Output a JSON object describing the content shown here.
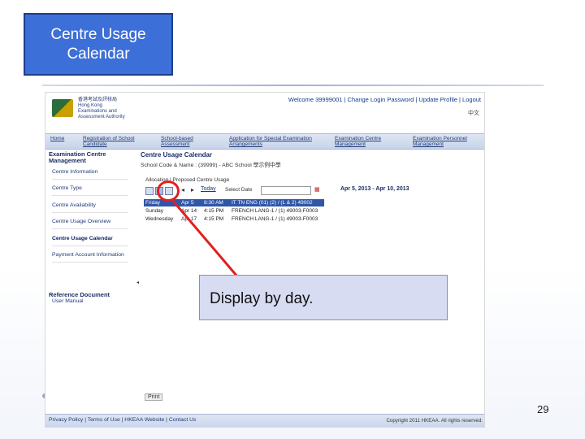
{
  "slide": {
    "title": "Centre Usage\nCalendar",
    "callout": "Display by day.",
    "page_number": "29"
  },
  "portal": {
    "logo_text": "香港考試及評核局\nHong Kong\nExaminations and\nAssessment Authority",
    "top_links": "Welcome 39999001 | Change Login Password | Update Profile | Logout",
    "language": "中文",
    "nav": [
      "Home",
      "Registration of School\nCandidate",
      "School-based\nAssessment",
      "Application for Special Examination\nArrangements",
      "Examination Centre\nManagement",
      "Examination Personnel\nManagement"
    ],
    "sidebar": {
      "heading": "Examination Centre\nManagement",
      "items": [
        "Centre Information",
        "Centre Type",
        "Centre Availability",
        "Centre Usage Overview",
        "Centre Usage Calendar",
        "Payment Account Information"
      ],
      "ref_heading": "Reference Document",
      "ref_item": "User Manual"
    },
    "main": {
      "title": "Centre Usage Calendar",
      "school": "School Code & Name : (39999) - ABC School   學示例中學",
      "tabs": "Allocation | Proposed Centre Usage",
      "toolbar": {
        "today": "Today",
        "select_date": "Select Date",
        "range": "Apr 5, 2013 - Apr 10, 2013"
      },
      "rows": [
        {
          "day": "Friday",
          "date": "Apr 5",
          "time": "8:30 AM",
          "exam": "IT TN ENG (01) (2) / (L & 2) 49002"
        },
        {
          "day": "Sunday",
          "date": "Apr 14",
          "time": "4:15 PM",
          "exam": "FRENCH LANG-1 / (1) 49003-F0003"
        },
        {
          "day": "Wednesday",
          "date": "Apr 17",
          "time": "4:15 PM",
          "exam": "FRENCH LANG-1 / (1) 49003-F0003"
        }
      ]
    },
    "print": "Print",
    "footer": {
      "links": "Privacy Policy | Terms of Use | HKEAA Website | Contact Us",
      "copyright": "Copyright 2011 HKEAA. All rights reserved."
    }
  },
  "colors": {
    "title_box": "#3d6fd8",
    "highlight": "#e02020",
    "callout_bg": "#d8dcf2"
  }
}
